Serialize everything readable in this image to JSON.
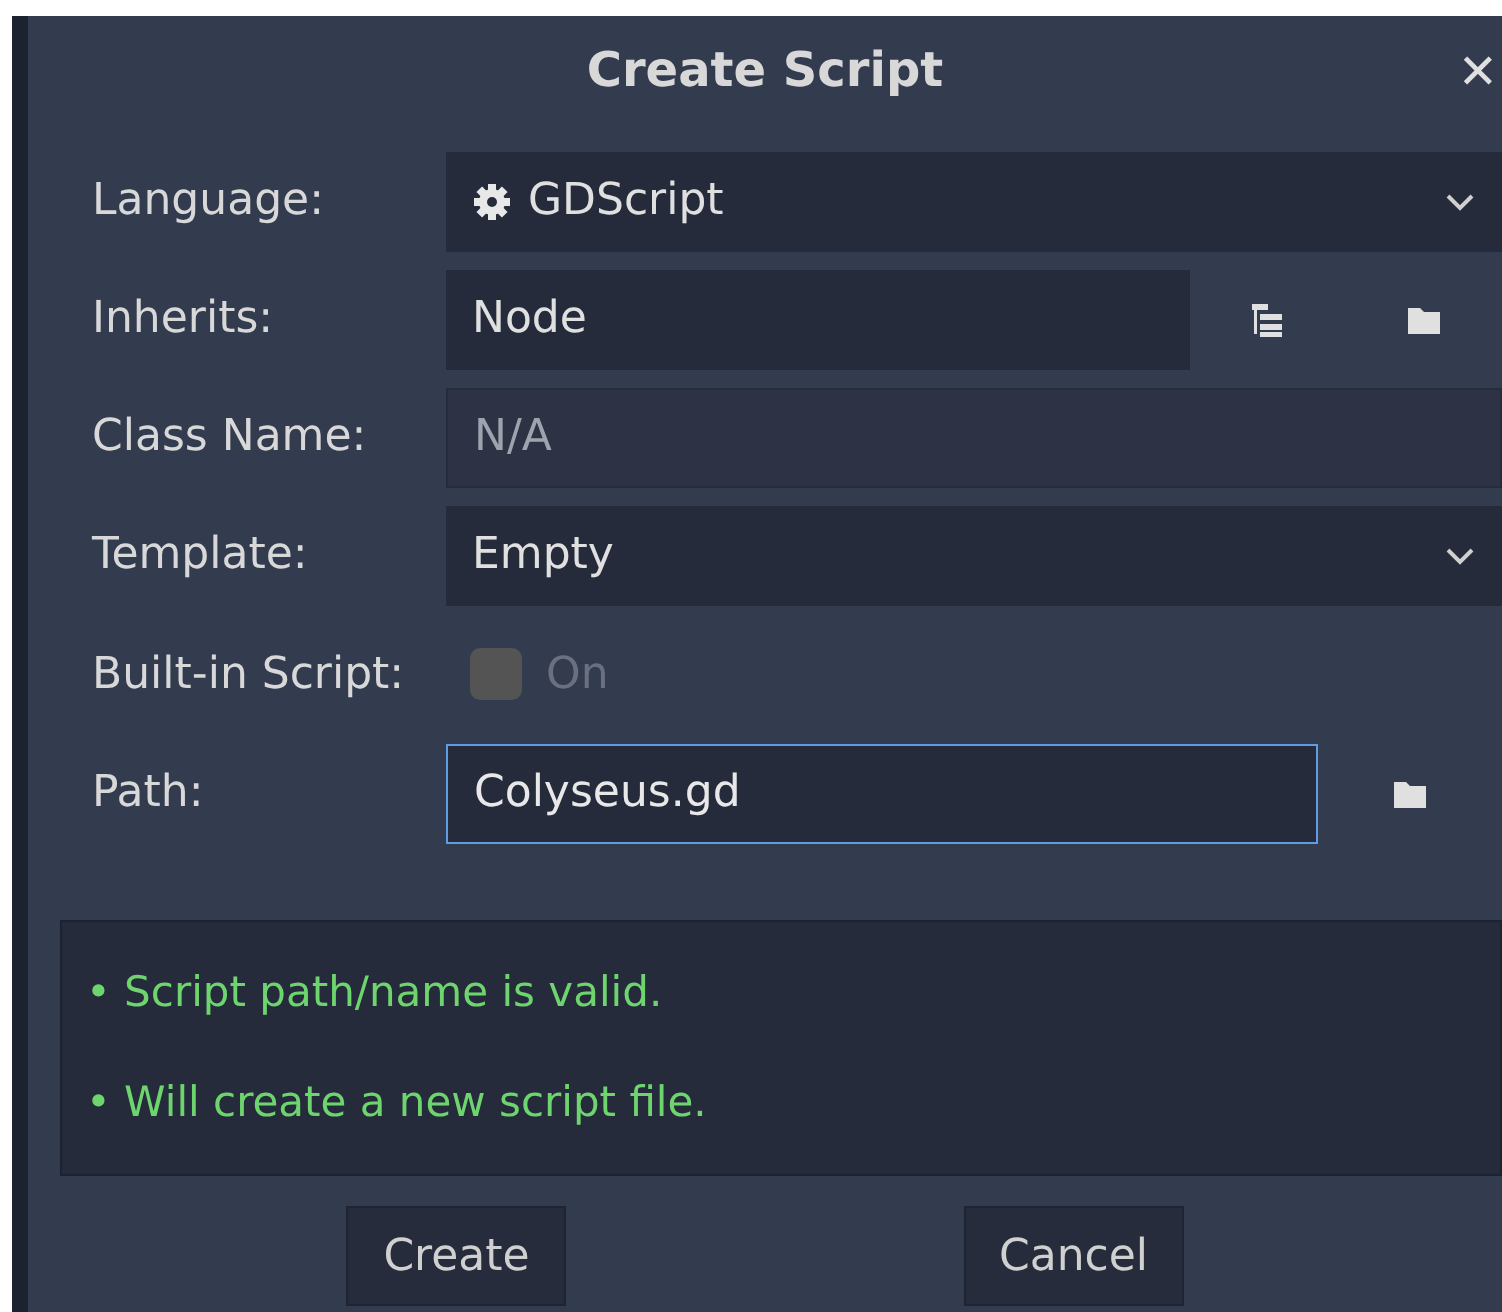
{
  "window": {
    "title": "Create Script",
    "close": "✕"
  },
  "rows": [
    {
      "kind": "dropdown",
      "label": "Language:",
      "value": "GDScript",
      "icon": true
    },
    {
      "kind": "browse",
      "label": "Inherits:",
      "value": "Node"
    },
    {
      "kind": "disabled",
      "label": "Class Name:",
      "placeholder": "N/A"
    },
    {
      "kind": "dropdown",
      "label": "Template:",
      "value": "Empty",
      "icon": false
    },
    {
      "kind": "checkbox",
      "label": "Built-in Script:",
      "value": "On",
      "checked": false,
      "disabled": true
    },
    {
      "kind": "path",
      "label": "Path:",
      "value": "Colyseus.gd",
      "focused": true
    }
  ],
  "messages": [
    "• Script path/name is valid.",
    "• Will create a new script file."
  ],
  "buttons": [
    "Create",
    "Cancel"
  ]
}
